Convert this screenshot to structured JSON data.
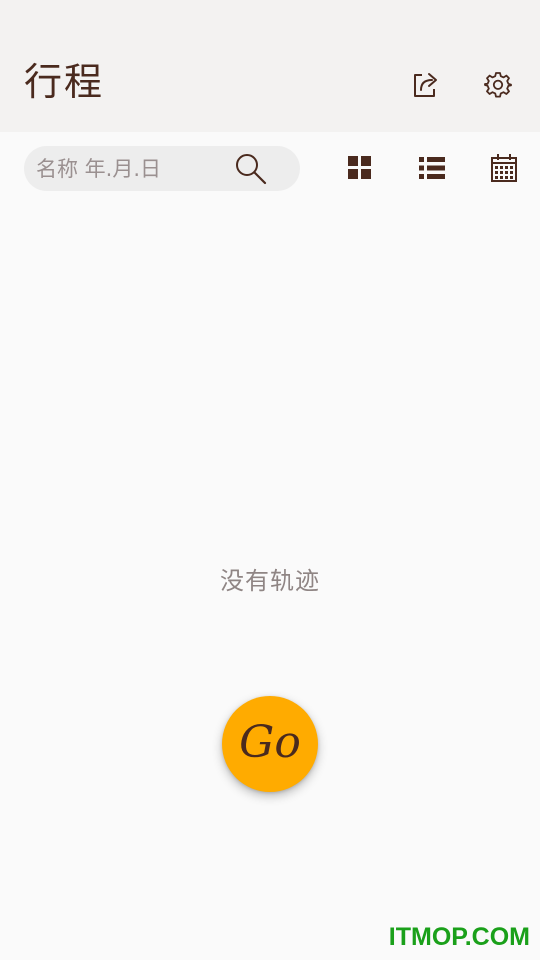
{
  "header": {
    "title": "行程",
    "export_icon": "export-share-icon",
    "settings_icon": "gear-icon"
  },
  "search": {
    "placeholder": "名称 年.月.日",
    "value": "",
    "icon": "search-icon"
  },
  "view_modes": [
    {
      "name": "grid",
      "icon": "grid-view-icon"
    },
    {
      "name": "list",
      "icon": "list-view-icon"
    },
    {
      "name": "calendar",
      "icon": "calendar-icon"
    }
  ],
  "main": {
    "empty_message": "没有轨迹"
  },
  "fab": {
    "label": "Go"
  },
  "watermark": "ITMOP.COM",
  "colors": {
    "header_bg": "#f3f2f1",
    "page_bg": "#fafafa",
    "primary_text": "#4a2a1e",
    "muted_text": "#8f8584",
    "fab_bg": "#ffab00",
    "watermark": "#1aa01a"
  }
}
